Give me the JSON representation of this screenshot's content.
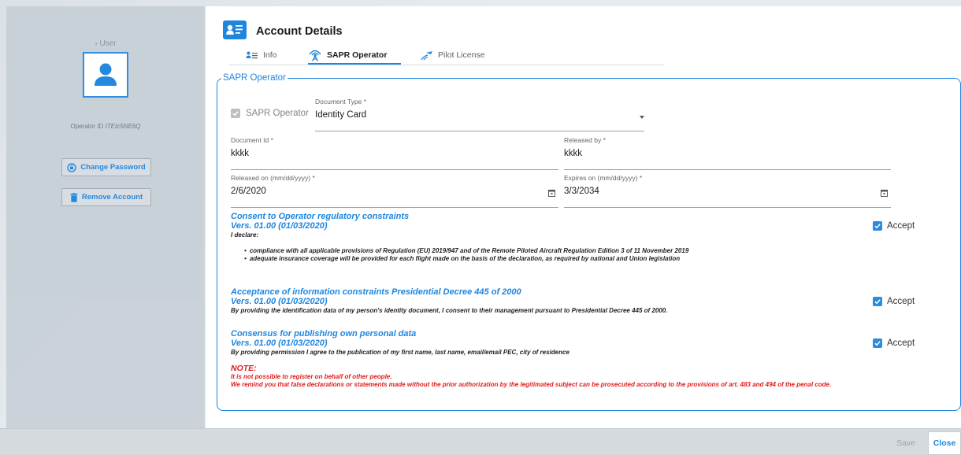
{
  "sidebar": {
    "user_label": "› User",
    "operator_id_label": "Operator ID",
    "operator_id_value": "ITEIc5NE6Q",
    "change_password": "Change Password",
    "remove_account": "Remove Account"
  },
  "header": {
    "title": "Account Details"
  },
  "tabs": [
    {
      "label": "Info",
      "icon": "info-list-icon"
    },
    {
      "label": "SAPR Operator",
      "icon": "antenna-icon",
      "active": true
    },
    {
      "label": "Pilot License",
      "icon": "license-icon"
    }
  ],
  "sapr": {
    "legend": "SAPR Operator",
    "checkbox_label": "SAPR Operator",
    "document_type_label": "Document Type *",
    "document_type_value": "Identity Card",
    "document_id_label": "Document Id *",
    "document_id_value": "kkkk",
    "released_by_label": "Released by *",
    "released_by_value": "kkkk",
    "released_on_label": "Released on (mm/dd/yyyy) *",
    "released_on_value": "2/6/2020",
    "expires_on_label": "Expires on (mm/dd/yyyy) *",
    "expires_on_value": "3/3/2034"
  },
  "consents": [
    {
      "title": "Consent to Operator regulatory constraints",
      "version": "Vers. 01.00 (01/03/2020)",
      "text": "I declare:",
      "items": [
        "compliance with all applicable provisions of Regulation (EU) 2019/947 and of the Remote Piloted Aircraft Regulation Edition 3 of 11 November 2019",
        "adequate insurance coverage will be provided for each flight made on the basis of the declaration, as required by national and Union legislation"
      ],
      "accept_label": "Accept"
    },
    {
      "title": "Acceptance of information constraints Presidential Decree 445 of 2000",
      "version": "Vers. 01.00 (01/03/2020)",
      "text": "By providing the identification data of my person's identity document, I consent to their management pursuant to Presidential Decree 445 of 2000.",
      "accept_label": "Accept"
    },
    {
      "title": "Consensus for publishing own personal data",
      "version": "Vers. 01.00 (01/03/2020)",
      "text": "By providing permission I agree to the publication of my first name, last name, email/email PEC, city of residence",
      "accept_label": "Accept"
    }
  ],
  "note": {
    "title": "NOTE:",
    "line1": "It is not possible to register on behalf of other people.",
    "line2": "We remind you that false declarations or statements made without the prior authorization by the legitimated subject can be prosecuted according to the provisions of art. 483 and 494 of the penal code."
  },
  "footer": {
    "save_label": "Save",
    "close_label": "Close"
  },
  "colors": {
    "accent": "#1e86df",
    "danger": "#e01b1b"
  }
}
